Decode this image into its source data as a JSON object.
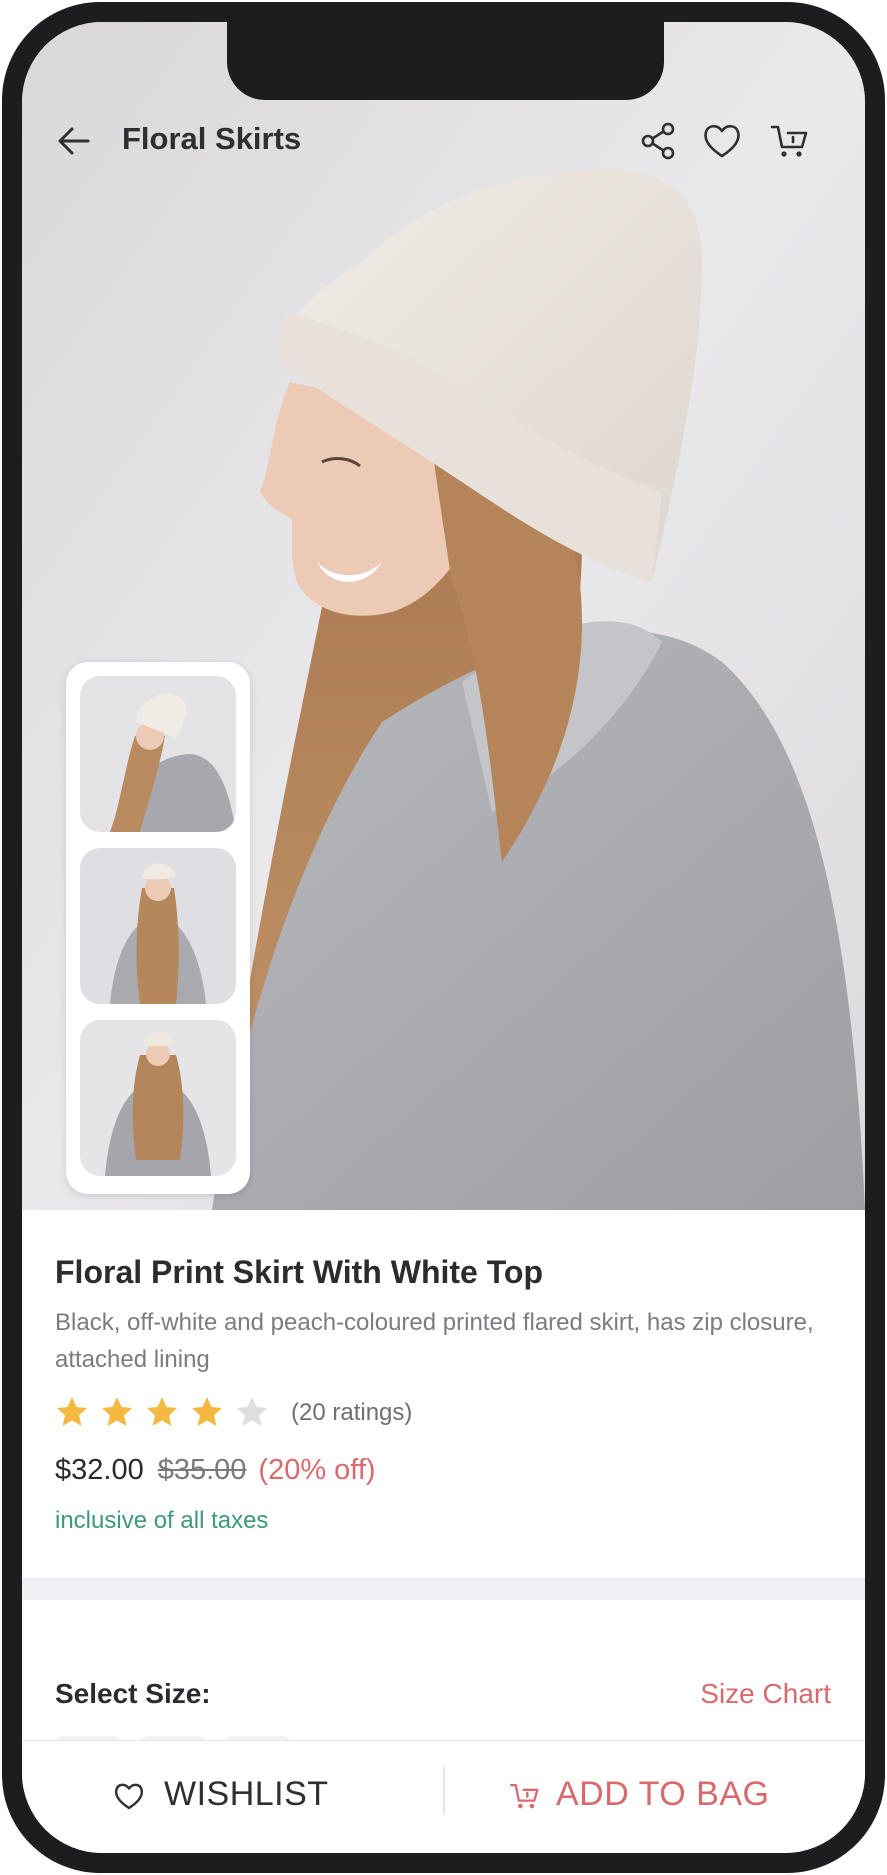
{
  "header": {
    "title": "Floral Skirts",
    "icons": [
      "back-arrow-icon",
      "share-icon",
      "heart-icon",
      "cart-icon"
    ]
  },
  "product": {
    "title": "Floral Print Skirt With White Top",
    "description": "Black, off-white and peach-coloured printed flared skirt, has zip closure, attached lining",
    "rating": {
      "stars": 4,
      "max": 5,
      "count_text": "(20 ratings)"
    },
    "price": "$32.00",
    "original_price": "$35.00",
    "discount": "(20% off)",
    "tax_note": "inclusive of all taxes"
  },
  "size": {
    "label": "Select Size:",
    "chart_link": "Size Chart"
  },
  "actions": {
    "wishlist": "WISHLIST",
    "add_to_bag": "ADD TO BAG"
  },
  "colors": {
    "accent": "#d9696d",
    "tax_green": "#3c9a78",
    "star": "#f5b942",
    "star_empty": "#dedede"
  }
}
